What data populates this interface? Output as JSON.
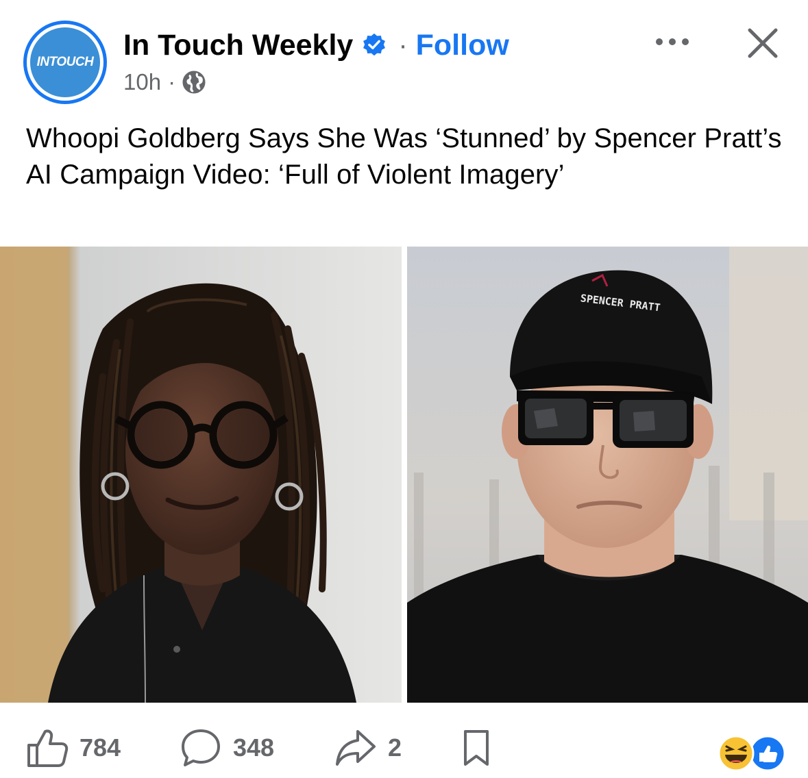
{
  "header": {
    "page_name": "In Touch Weekly",
    "separator": "·",
    "follow_label": "Follow",
    "time": "10h",
    "meta_separator": "·",
    "avatar_logo_text": "INTOUCH"
  },
  "post": {
    "caption": "Whoopi Goldberg Says She Was ‘Stunned’ by Spencer Pratt’s AI Campaign Video: ‘Full of Violent Imagery’",
    "cap_text": "SPENCER PRATT"
  },
  "actions": {
    "likes": "784",
    "comments": "348",
    "shares": "2"
  },
  "icons": {
    "verified": "verified-badge-icon",
    "globe": "globe-icon",
    "more": "more-options-icon",
    "close": "close-icon",
    "like": "thumbs-up-icon",
    "comment": "comment-bubble-icon",
    "share": "share-arrow-icon",
    "save": "bookmark-icon",
    "reactions": [
      "haha-reaction-icon",
      "like-reaction-icon"
    ]
  },
  "colors": {
    "accent": "#1877f2",
    "secondary_text": "#65676b",
    "avatar_bg": "#3b8fd6"
  }
}
